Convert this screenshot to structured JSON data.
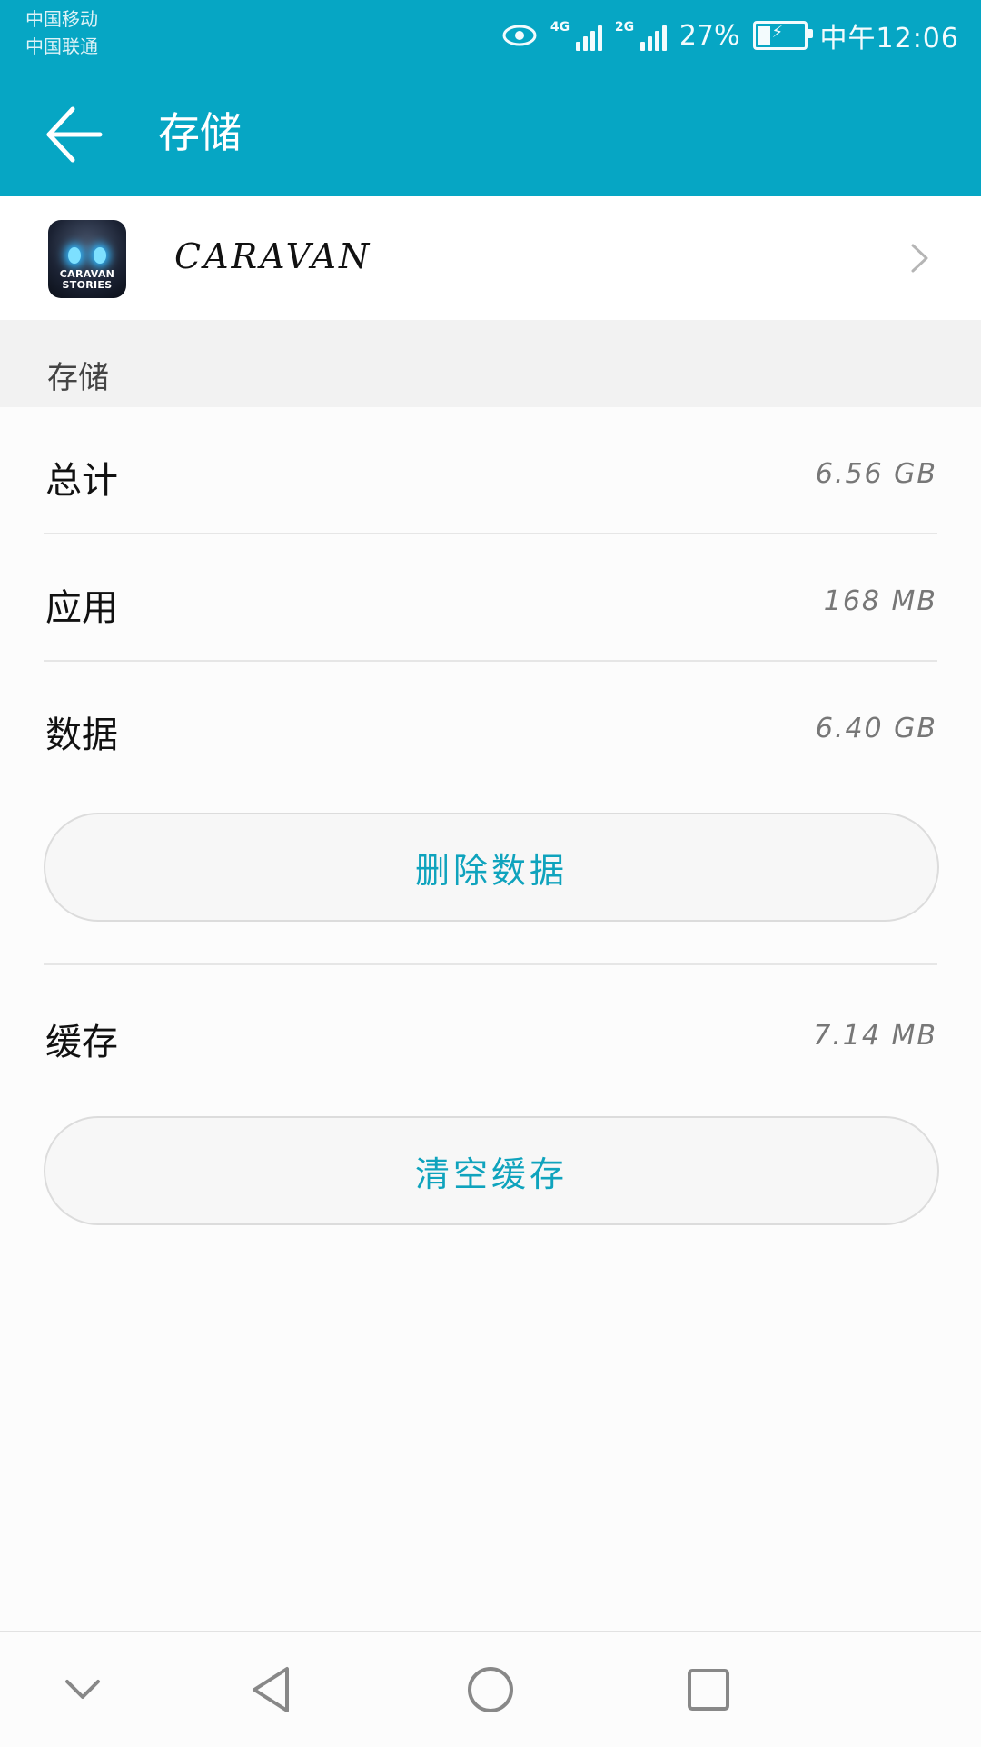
{
  "status_bar": {
    "carrier_1": "中国移动",
    "carrier_2": "中国联通",
    "signal_1_label": "4G",
    "signal_2_label": "2G",
    "battery_percent": "27%",
    "battery_level": 0.27,
    "time": "中午12:06",
    "icons": [
      "eye-icon",
      "signal-icon",
      "signal-icon",
      "battery-charging-icon"
    ]
  },
  "app_bar": {
    "title": "存储",
    "back_icon": "arrow-left-icon"
  },
  "app_row": {
    "name": "CARAVAN",
    "icon_text": "CARAVAN STORIES",
    "chevron_icon": "chevron-right-icon"
  },
  "storage": {
    "section_title": "存储",
    "total_label": "总计",
    "total_value": "6.56 GB",
    "app_label": "应用",
    "app_value": "168 MB",
    "data_label": "数据",
    "data_value": "6.40 GB",
    "delete_data_button": "删除数据",
    "cache_label": "缓存",
    "cache_value": "7.14 MB",
    "clear_cache_button": "清空缓存"
  },
  "nav_bar": {
    "icons": [
      "chevron-down-icon",
      "back-triangle-icon",
      "home-circle-icon",
      "recents-square-icon"
    ]
  },
  "colors": {
    "accent": "#06a6c4",
    "button_text": "#0fa3bd",
    "section_bg": "#f2f2f2"
  }
}
